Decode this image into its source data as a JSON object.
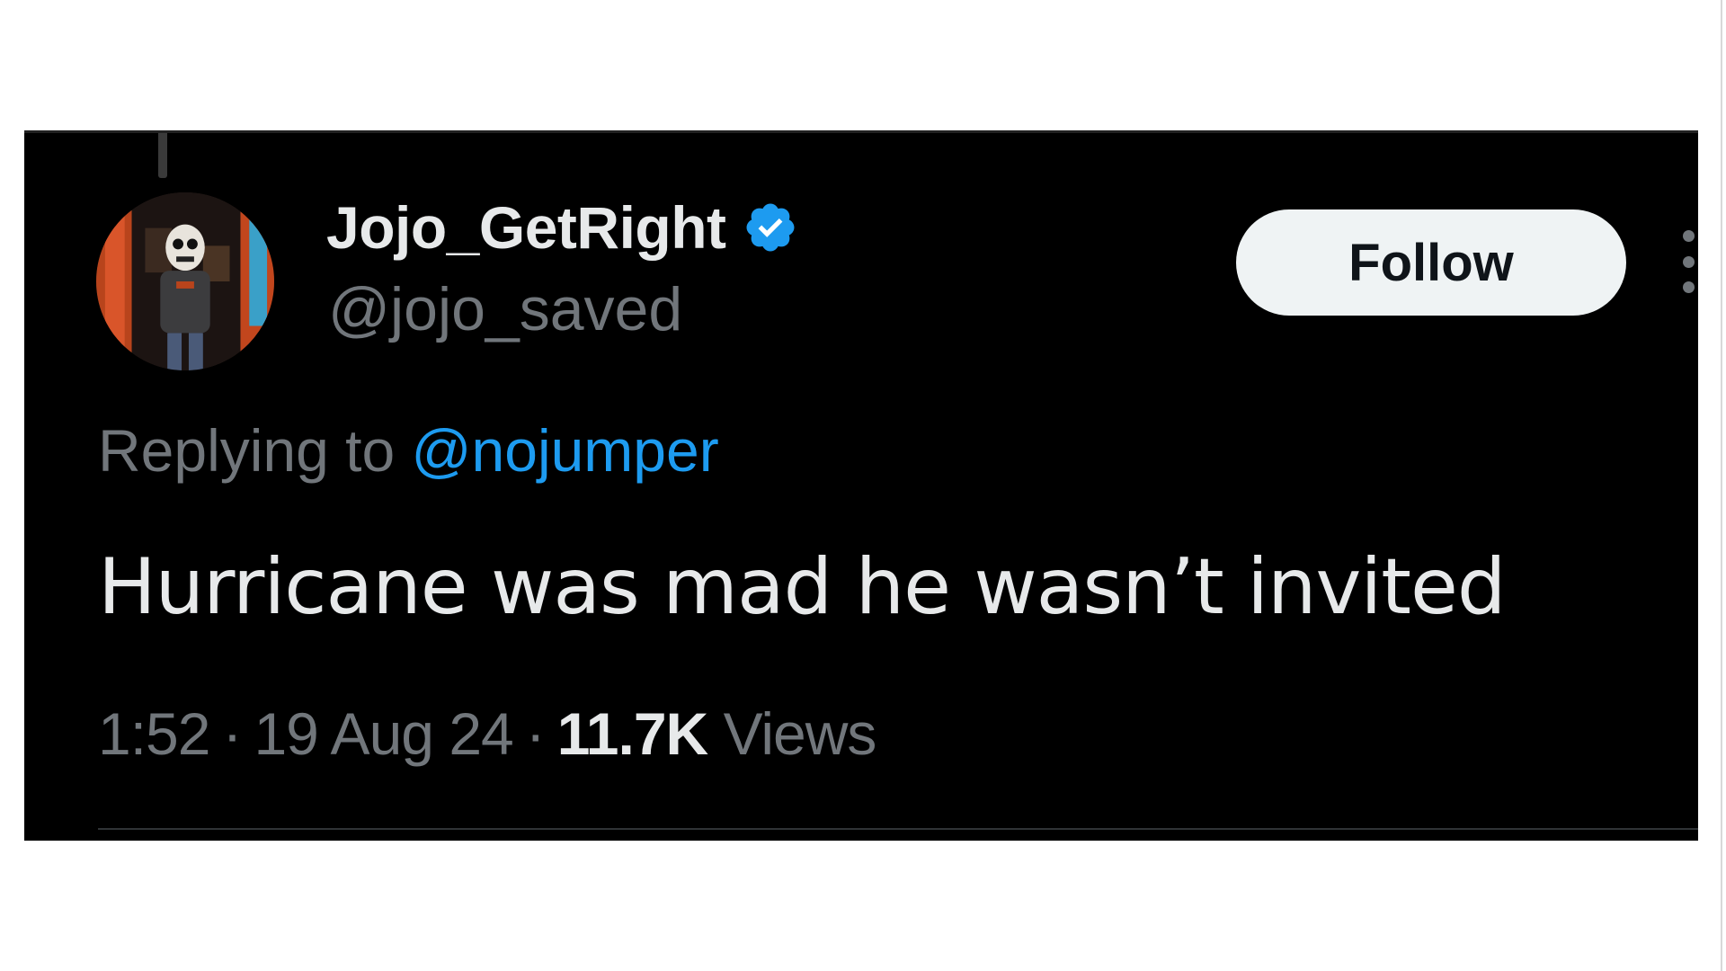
{
  "tweet": {
    "author": {
      "display_name": "Jojo_GetRight",
      "handle": "@jojo_saved",
      "verified_icon": "verified-badge-icon",
      "avatar": "avatar-photo"
    },
    "follow_label": "Follow",
    "more_icon": "more-options-icon",
    "reply": {
      "prefix": "Replying to ",
      "mention": "@nojumper"
    },
    "text": "Hurricane was mad he wasn’t invited",
    "meta": {
      "time": "1:52",
      "separator": "·",
      "date": "19 Aug 24",
      "views_count": "11.7K",
      "views_label": "Views"
    }
  },
  "colors": {
    "background": "#000000",
    "primary_text": "#e7e9ea",
    "secondary_text": "#71767b",
    "accent": "#1d9bf0",
    "follow_button_bg": "#eff3f4"
  }
}
